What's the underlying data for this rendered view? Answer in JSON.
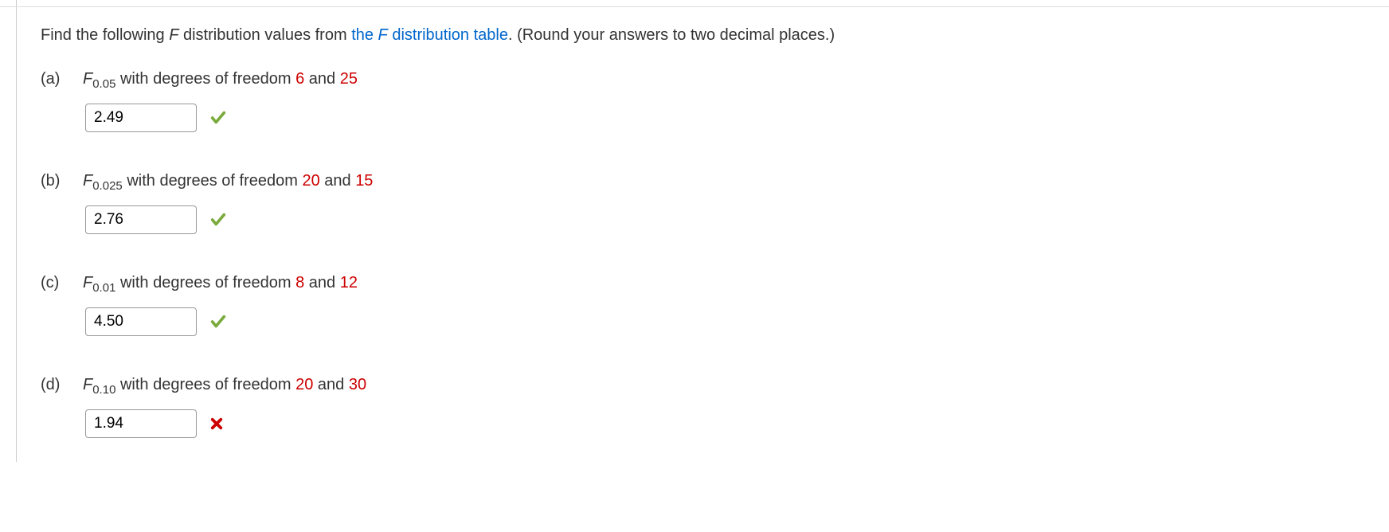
{
  "instruction": {
    "prefix": "Find the following ",
    "italic_f": "F",
    "mid1": " distribution values from ",
    "link_prefix": "the ",
    "link_italic": "F",
    "link_suffix": " distribution table",
    "suffix": ". (Round your answers to two decimal places.)"
  },
  "questions": [
    {
      "part": "(a)",
      "f_label": "F",
      "subscript": "0.05",
      "text_mid": " with degrees of freedom ",
      "df1": "6",
      "text_and": " and ",
      "df2": "25",
      "answer": "2.49",
      "status": "correct"
    },
    {
      "part": "(b)",
      "f_label": "F",
      "subscript": "0.025",
      "text_mid": " with degrees of freedom ",
      "df1": "20",
      "text_and": " and ",
      "df2": "15",
      "answer": "2.76",
      "status": "correct"
    },
    {
      "part": "(c)",
      "f_label": "F",
      "subscript": "0.01",
      "text_mid": " with degrees of freedom ",
      "df1": "8",
      "text_and": " and ",
      "df2": "12",
      "answer": "4.50",
      "status": "correct"
    },
    {
      "part": "(d)",
      "f_label": "F",
      "subscript": "0.10",
      "text_mid": " with degrees of freedom ",
      "df1": "20",
      "text_and": " and ",
      "df2": "30",
      "answer": "1.94",
      "status": "incorrect"
    }
  ]
}
